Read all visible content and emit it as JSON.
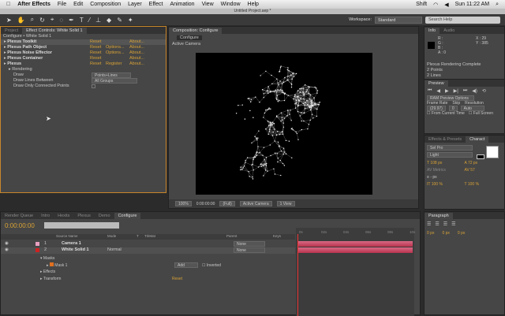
{
  "menubar": {
    "app": "After Effects",
    "items": [
      "File",
      "Edit",
      "Composition",
      "Layer",
      "Effect",
      "Animation",
      "View",
      "Window",
      "Help"
    ],
    "status": [
      "Shift",
      "Sun 11:22 AM"
    ]
  },
  "title": "Untitled Project.aep *",
  "workspace": {
    "label": "Workspace:",
    "value": "Standard",
    "search_placeholder": "Search Help"
  },
  "left": {
    "tabs": [
      "Project",
      "Effect Controls: White Solid 1"
    ],
    "breadcrumb": "Configure • White Solid 1",
    "effects": [
      {
        "name": "Plexus Toolkit",
        "a": "Reset",
        "b": "",
        "c": "About..."
      },
      {
        "name": "Plexus Path Object",
        "a": "Reset",
        "b": "Options...",
        "c": "About..."
      },
      {
        "name": "Plexus Noise Effector",
        "a": "Reset",
        "b": "Options...",
        "c": "About..."
      },
      {
        "name": "Plexus Container",
        "a": "Reset",
        "b": "",
        "c": "About..."
      },
      {
        "name": "Plexus",
        "a": "Reset",
        "b": "Register",
        "c": "About..."
      }
    ],
    "rendering": "Rendering",
    "props": [
      {
        "label": "Draw",
        "value": "Points+Lines"
      },
      {
        "label": "Draw Lines Between",
        "value": "All Groups"
      },
      {
        "label": "Draw Only Connected Points",
        "value": ""
      }
    ]
  },
  "comp": {
    "tab": "Composition: Configure",
    "subtab": "Configure",
    "camera": "Active Camera",
    "footer": {
      "zoom": "100%",
      "time": "0:00:00:00",
      "res": "(Full)",
      "cam": "Active Camera",
      "view": "1 View"
    }
  },
  "info": {
    "tabs": [
      "Info",
      "Audio"
    ],
    "r": "R :",
    "g": "G :",
    "b": "B :",
    "a": "A : 0",
    "x": "X : 29",
    "y": "Y : 385",
    "status": [
      "Plexus Rendering Complete",
      "2 Points",
      "2 Lines"
    ]
  },
  "preview": {
    "tab": "Preview",
    "options": "RAM Preview Options",
    "frame_rate_label": "Frame Rate",
    "skip_label": "Skip",
    "resolution_label": "Resolution",
    "frame_rate": "(29.97)",
    "skip": "0",
    "resolution": "Auto",
    "from_current": "From Current Time",
    "full_screen": "Full Screen"
  },
  "character": {
    "tabs": [
      "Effects & Presets",
      "Charact"
    ],
    "font": "Sel Pro",
    "style": "Light",
    "size": "108 px",
    "leading": "72 px",
    "kerning": "Metrics",
    "tracking": "57",
    "stroke": "- px",
    "vscale": "100 %",
    "hscale": "100 %"
  },
  "paragraph": {
    "tab": "Paragraph",
    "indents": [
      "0 px",
      "0 px",
      "0 px"
    ]
  },
  "timeline": {
    "tabs": [
      "Render Queue",
      "Intro",
      "Hexits",
      "Plexus",
      "Demo",
      "Configure"
    ],
    "time": "0:00:00:00",
    "headers": [
      "Source Name",
      "Mode",
      "T",
      "TrkMat",
      "Parent",
      "Keys"
    ],
    "layers": [
      {
        "num": "1",
        "name": "Camera 1",
        "mode": "",
        "parent": "None",
        "color": "#e8a0c0"
      },
      {
        "num": "2",
        "name": "White Solid 1",
        "mode": "Normal",
        "parent": "None",
        "color": "#cc2222"
      }
    ],
    "sub": {
      "masks": "Masks",
      "mask1": "Mask 1",
      "mask_mode": "Add",
      "inverted": "Inverted",
      "effects": "Effects",
      "transform": "Transform",
      "reset": "Reset"
    },
    "ruler": [
      "0s",
      "02s",
      "04s",
      "06s",
      "08s",
      "10s"
    ]
  }
}
